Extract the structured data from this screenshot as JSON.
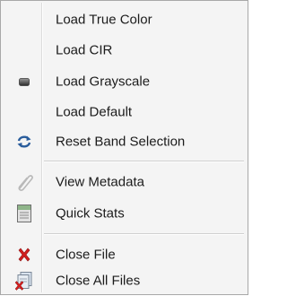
{
  "menu": {
    "items": [
      {
        "label": "Load True Color",
        "icon": ""
      },
      {
        "label": "Load CIR",
        "icon": ""
      },
      {
        "label": "Load Grayscale",
        "icon": "selected-bullet-icon"
      },
      {
        "label": "Load Default",
        "icon": ""
      },
      {
        "label": "Reset Band Selection",
        "icon": "refresh-icon"
      },
      {
        "label": "View Metadata",
        "icon": "paperclip-icon"
      },
      {
        "label": "Quick Stats",
        "icon": "stats-document-icon"
      },
      {
        "label": "Close File",
        "icon": "red-x-icon"
      },
      {
        "label": "Close All Files",
        "icon": "close-all-files-icon"
      }
    ]
  },
  "colors": {
    "menu_background": "#f4f4f4",
    "close_red": "#d21f1f",
    "refresh_blue": "#2a5d9c"
  }
}
